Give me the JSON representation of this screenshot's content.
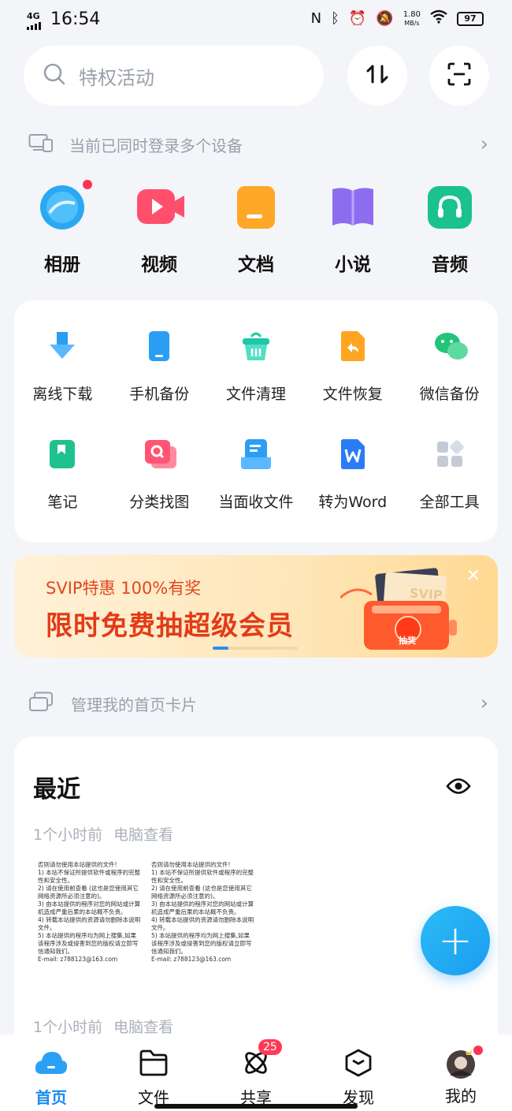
{
  "status_bar": {
    "network": "4G",
    "time": "16:54",
    "speed_value": "1.80",
    "speed_unit": "MB/s",
    "battery": "97"
  },
  "search": {
    "placeholder": "特权活动"
  },
  "device_notice": {
    "text": "当前已同时登录多个设备"
  },
  "apps": [
    {
      "label": "相册",
      "icon": "photo-album-icon",
      "color": "#2aa8f2"
    },
    {
      "label": "视频",
      "icon": "video-icon",
      "color": "#ff4f6d"
    },
    {
      "label": "文档",
      "icon": "document-icon",
      "color": "#ffa726"
    },
    {
      "label": "小说",
      "icon": "novel-book-icon",
      "color": "#8e6cf0"
    },
    {
      "label": "音频",
      "icon": "audio-headphones-icon",
      "color": "#19c28e"
    }
  ],
  "tools": [
    {
      "label": "离线下载",
      "icon": "offline-download-icon",
      "color": "#2a9df4"
    },
    {
      "label": "手机备份",
      "icon": "phone-backup-icon",
      "color": "#2a9df4"
    },
    {
      "label": "文件清理",
      "icon": "file-clean-icon",
      "color": "#20c6a7"
    },
    {
      "label": "文件恢复",
      "icon": "file-restore-icon",
      "color": "#ffa520"
    },
    {
      "label": "微信备份",
      "icon": "wechat-backup-icon",
      "color": "#22c47a"
    },
    {
      "label": "笔记",
      "icon": "note-icon",
      "color": "#1fc18f"
    },
    {
      "label": "分类找图",
      "icon": "image-search-icon",
      "color": "#ff5573"
    },
    {
      "label": "当面收文件",
      "icon": "receive-file-icon",
      "color": "#2a9df4"
    },
    {
      "label": "转为Word",
      "icon": "word-convert-icon",
      "color": "#2a7cf4"
    },
    {
      "label": "全部工具",
      "icon": "all-tools-icon",
      "color": "#c5cbd5"
    }
  ],
  "banner": {
    "subtitle": "SVIP特惠 100%有奖",
    "title": "限时免费抽超级会员",
    "ticket_text": "SVIP",
    "button_text": "抽奖"
  },
  "manage_cards": {
    "text": "管理我的首页卡片"
  },
  "recent": {
    "title": "最近",
    "groups": [
      {
        "time": "1个小时前",
        "source": "电脑查看"
      },
      {
        "time": "1个小时前",
        "source": "电脑查看"
      }
    ],
    "doc_lines": [
      "否则请勿使用本站提供的文件!",
      "1) 本站不保证所提供软件或程序的完整性和安全性。",
      "2) 请在使用前查看 (这也是您使用其它网络资源所必须注意的)。",
      "3) 由本站提供的程序对您的网站或计算机造成严重后果的本站概不负责。",
      "4) 转载本站提供的资源请勿删除本说明文件。",
      "5) 本站提供的程序均为网上搜集,如果该程序涉及或侵害到您的版权请立即写信通知我们。",
      "E-mail: z788123@163.com"
    ]
  },
  "nav": {
    "items": [
      {
        "label": "首页",
        "icon": "home-cloud-icon",
        "active": true
      },
      {
        "label": "文件",
        "icon": "folder-icon",
        "active": false
      },
      {
        "label": "共享",
        "icon": "share-atom-icon",
        "active": false,
        "badge": "25"
      },
      {
        "label": "发现",
        "icon": "discover-cube-icon",
        "active": false
      },
      {
        "label": "我的",
        "icon": "avatar-icon",
        "active": false
      }
    ]
  }
}
